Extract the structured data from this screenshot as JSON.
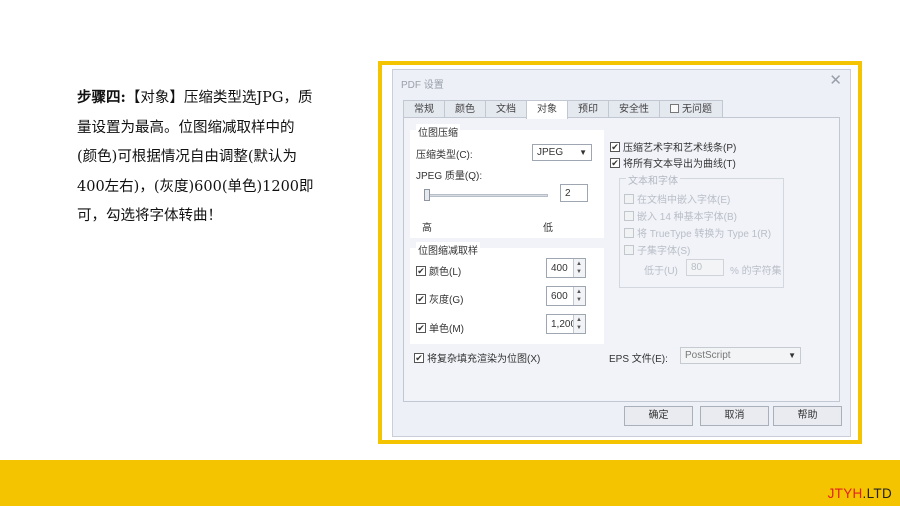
{
  "instructions": {
    "step_label": "步骤四:",
    "line1_rest": "【对象】压缩类型选JPG，质",
    "line2": "量设置为最高。位图缩减取样中的",
    "line3": "(颜色)可根据情况自由调整(默认为",
    "line4": "400左右)，(灰度)600(单色)1200即",
    "line5": "可，勾选将字体转曲！"
  },
  "dialog": {
    "title": "PDF 设置",
    "close_glyph": "✕",
    "tabs": [
      "常规",
      "颜色",
      "文档",
      "对象",
      "预印",
      "安全性",
      "无问题"
    ],
    "active_tab": "对象",
    "compression": {
      "group_title": "位图压缩",
      "type_label": "压缩类型(C):",
      "type_value": "JPEG",
      "quality_label": "JPEG 质量(Q):",
      "quality_value": "2",
      "high_label": "高",
      "low_label": "低",
      "quality_slider_fraction": 0
    },
    "downsampling": {
      "group_title": "位图缩减取样",
      "items": [
        {
          "label": "颜色(L)",
          "value": "400",
          "checked": true
        },
        {
          "label": "灰度(G)",
          "value": "600",
          "checked": true
        },
        {
          "label": "单色(M)",
          "value": "1,200",
          "checked": true
        }
      ]
    },
    "render_complex_fills": {
      "label": "将复杂填充渲染为位图(X)",
      "checked": true
    },
    "compress_art_text": {
      "label": "压缩艺术字和艺术线条(P)",
      "checked": true
    },
    "text_to_curves": {
      "label": "将所有文本导出为曲线(T)",
      "checked": true
    },
    "text_fonts": {
      "group_title": "文本和字体",
      "embed_doc_fonts": "在文档中嵌入字体(E)",
      "embed_base14": "嵌入 14 种基本字体(B)",
      "truetype_to_type1": "将 TrueType 转换为 Type 1(R)",
      "subset_fonts": "子集字体(S)",
      "below_label": "低于(U)",
      "below_value": "80",
      "percent_chars": "% 的字符集"
    },
    "eps": {
      "label": "EPS 文件(E):",
      "value": "PostScript"
    },
    "buttons": {
      "ok": "确定",
      "cancel": "取消",
      "help": "帮助"
    },
    "check_glyph": "✔",
    "dropdown_glyph": "▼",
    "spin_up_glyph": "▲",
    "spin_down_glyph": "▼"
  },
  "brand": {
    "accent": "JTYH",
    "rest": ".LTD"
  },
  "colors": {
    "band": "#f5c400",
    "frame": "#f5c400",
    "brand_accent": "#e31f1f"
  }
}
